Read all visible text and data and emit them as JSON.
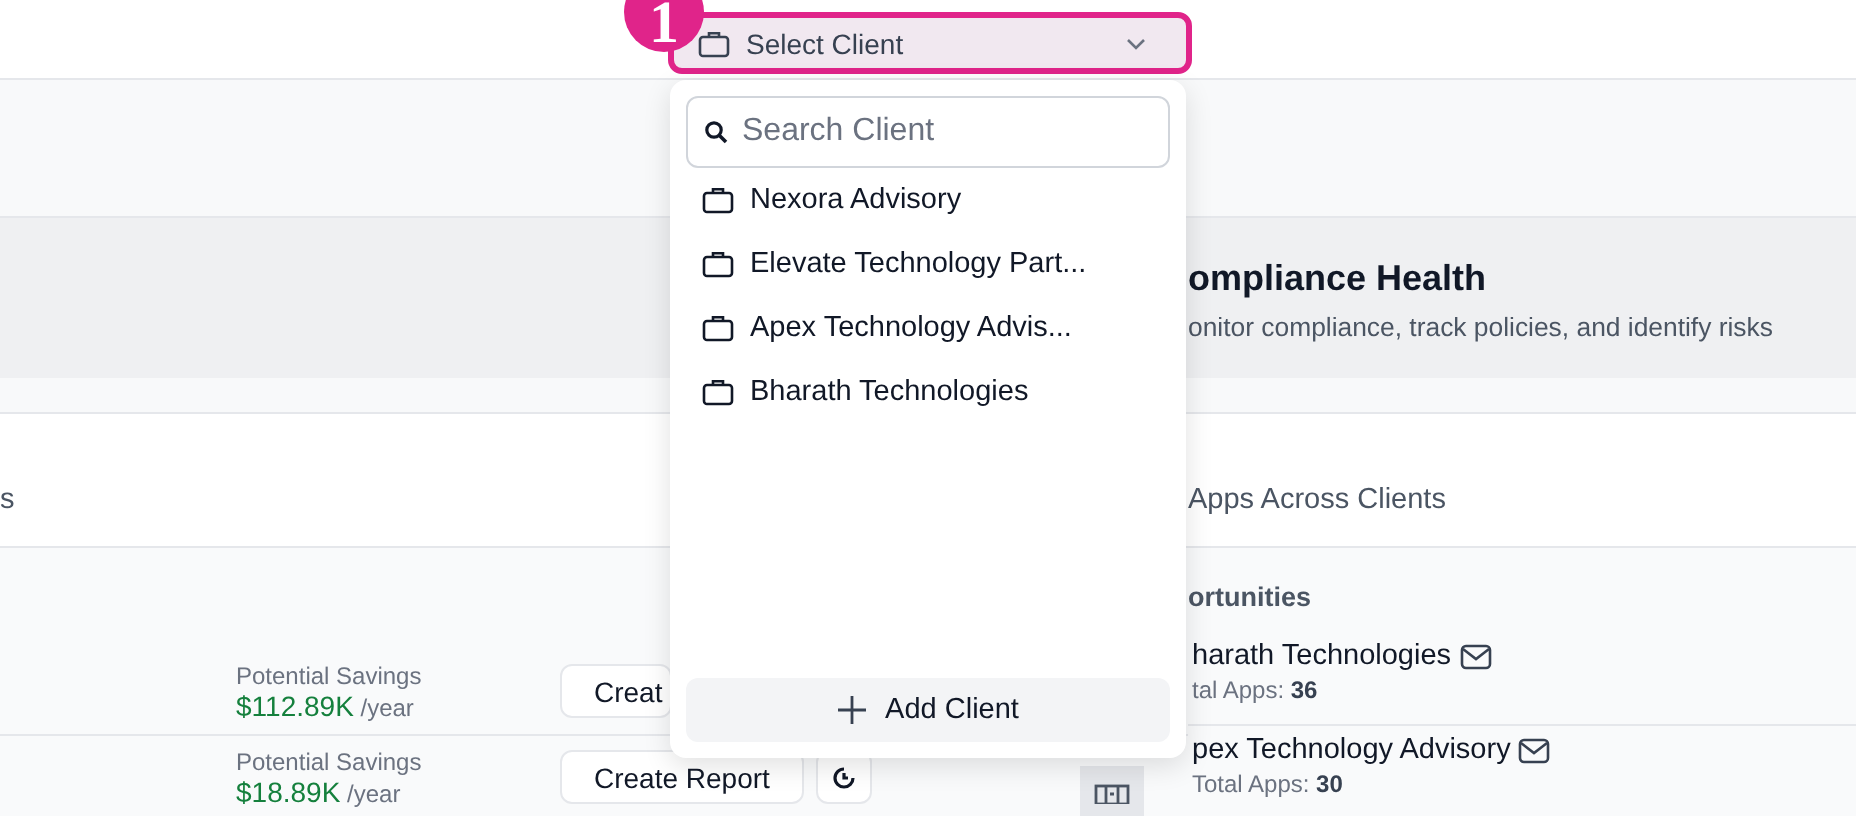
{
  "top_bar": {
    "badge": "1",
    "client_select": {
      "label": "Select Client"
    }
  },
  "dropdown": {
    "search": {
      "placeholder": "Search Client"
    },
    "clients": [
      {
        "name": "Nexora Advisory"
      },
      {
        "name": "Elevate Technology Part..."
      },
      {
        "name": "Apex Technology Advis..."
      },
      {
        "name": "Bharath Technologies"
      }
    ],
    "add_button": "Add Client"
  },
  "header": {
    "title": "ompliance Health",
    "subtitle": "onitor compliance, track policies, and identify risks"
  },
  "section": {
    "left_title": "s",
    "right_title": "Apps Across Clients"
  },
  "savings_rows": [
    {
      "label": "Potential Savings",
      "amount": "$112.89K",
      "unit": "/year",
      "button": "Creat"
    },
    {
      "label": "Potential Savings",
      "amount": "$18.89K",
      "unit": "/year",
      "button": "Create Report"
    }
  ],
  "opportunities": {
    "title": "ortunities",
    "clients": [
      {
        "name": "harath Technologies",
        "apps_label": "tal Apps:",
        "apps": "36"
      },
      {
        "name": "pex Technology Advisory",
        "apps_label": "Total Apps:",
        "apps": "30"
      }
    ]
  }
}
